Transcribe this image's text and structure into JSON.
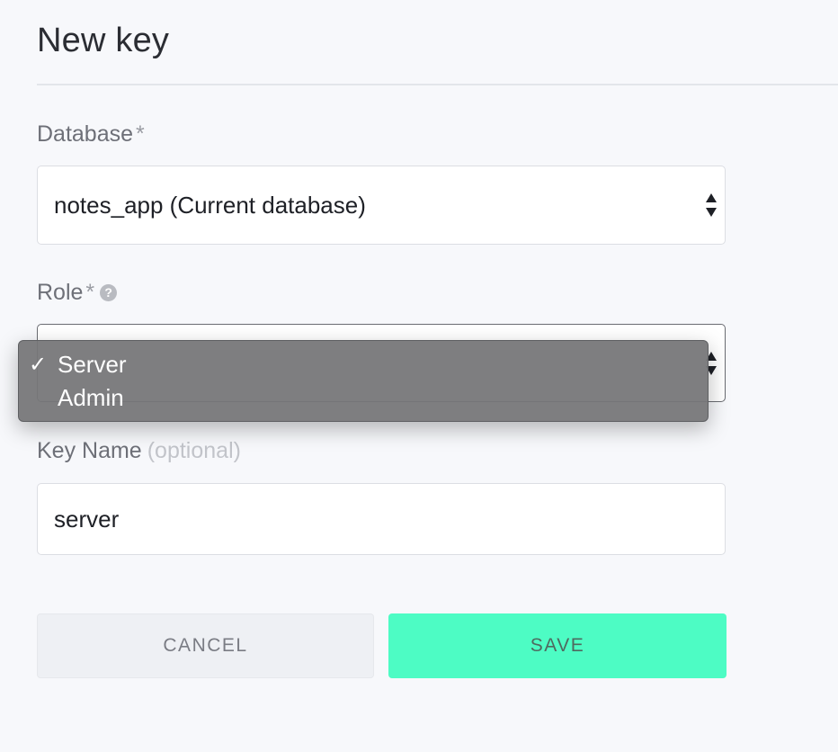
{
  "header": {
    "title": "New key"
  },
  "form": {
    "database": {
      "label": "Database",
      "required_mark": "*",
      "value": "notes_app (Current database)"
    },
    "role": {
      "label": "Role",
      "required_mark": "*",
      "help_icon": "question-circle-icon",
      "value": "Server",
      "options": [
        {
          "label": "Server",
          "selected": true,
          "check": "✓"
        },
        {
          "label": "Admin",
          "selected": false,
          "check": ""
        }
      ]
    },
    "key_name": {
      "label": "Key Name",
      "optional_note": "(optional)",
      "value": "server"
    }
  },
  "actions": {
    "cancel_label": "CANCEL",
    "save_label": "SAVE"
  },
  "colors": {
    "save_accent": "#4dfcc4",
    "background": "#f7f8fb"
  }
}
